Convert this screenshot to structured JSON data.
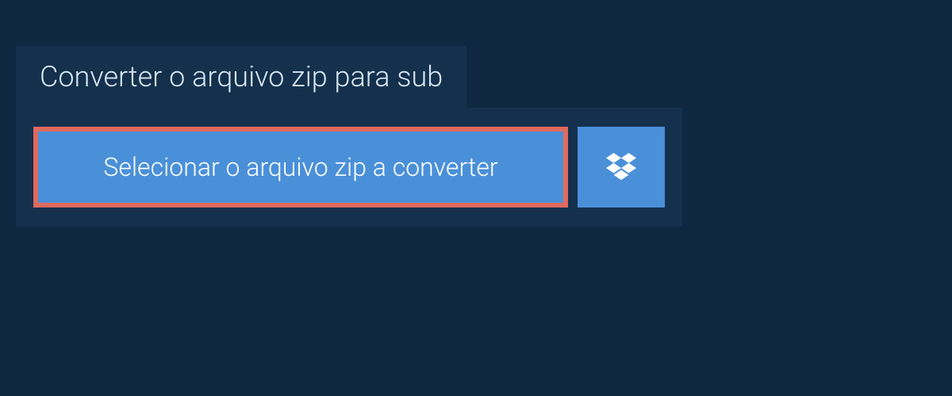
{
  "tab": {
    "label": "Converter o arquivo zip para sub"
  },
  "actions": {
    "select_file_label": "Selecionar o arquivo zip a converter"
  }
}
